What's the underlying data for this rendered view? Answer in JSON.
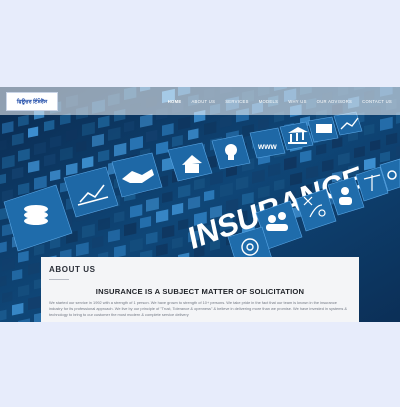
{
  "logo": {
    "text": "ਫਿਊਚਰ ਇੰਸ਼ੋਰੈਂਸ"
  },
  "nav": {
    "items": [
      {
        "label": "HOME",
        "active": true
      },
      {
        "label": "ABOUT US"
      },
      {
        "label": "SERVICES"
      },
      {
        "label": "MODELS"
      },
      {
        "label": "WHY US"
      },
      {
        "label": "OUR ADVISORS"
      },
      {
        "label": "CONTACT US"
      }
    ]
  },
  "hero": {
    "headline": "INSURANCE",
    "tile_icons": [
      "coins-icon",
      "chart-icon",
      "handshake-icon",
      "house-icon",
      "lightbulb-icon",
      "www-icon",
      "bank-icon",
      "money-icon",
      "growth-chart-icon",
      "users-icon",
      "strategy-icon",
      "person-icon",
      "scales-icon",
      "target-icon",
      "gear-icon"
    ],
    "tile_text": "www",
    "colors": {
      "deep": "#0d3b68",
      "tile": "#1b5f95",
      "tile_light": "#3d8fd0",
      "highlight": "#ffffff"
    }
  },
  "about": {
    "heading": "ABOUT US",
    "subject": "INSURANCE IS A SUBJECT MATTER OF SOLICITATION",
    "paragraph": "We started our service in 1992 with a strength of 1 person. We have grown to strength of 10+ persons. We take pride in the fact that our team is known in the insurance industry for its professional approach. We live by our principle of \"Trust, Tolerance & openness\" & believe in delivering more than we promise. We have invested in systems & technology to bring to our customer the most modern & complete service delivery"
  }
}
